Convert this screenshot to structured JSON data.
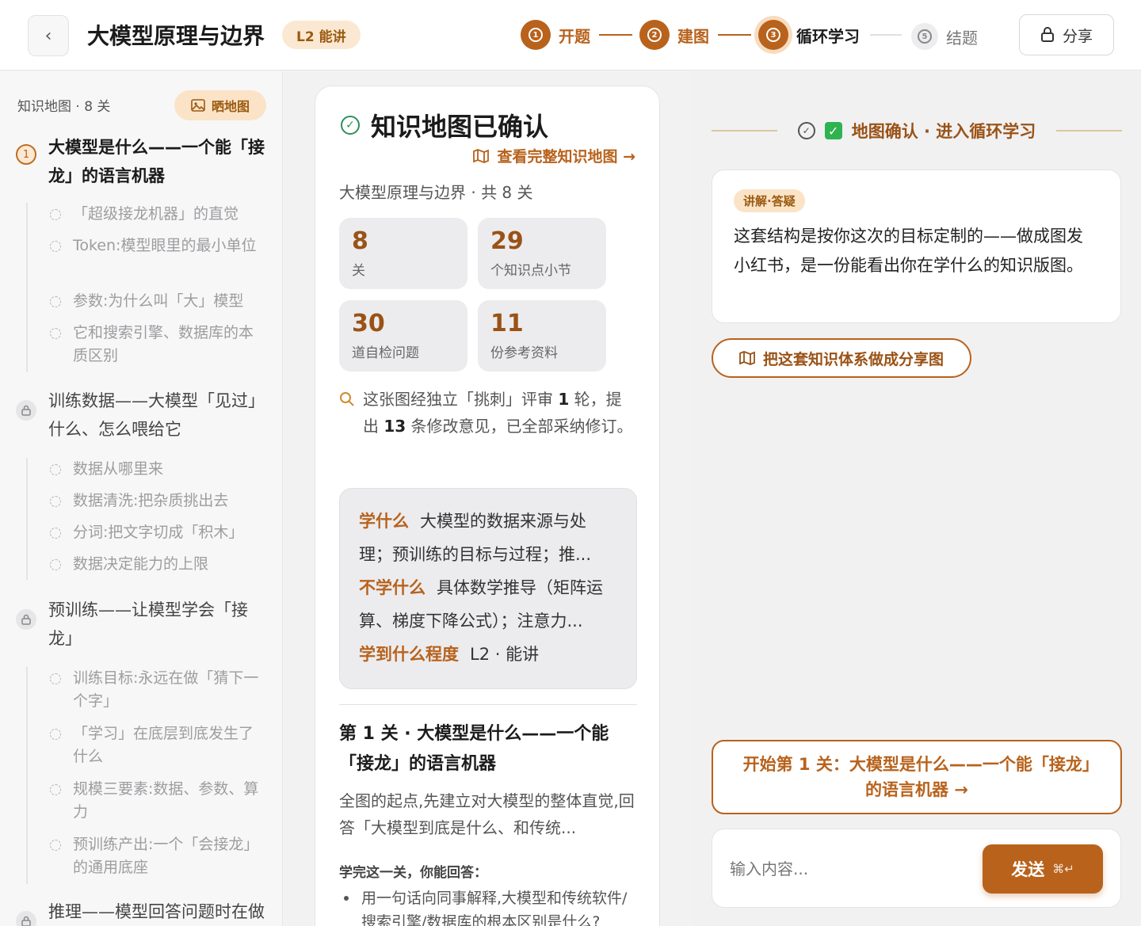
{
  "header": {
    "back_icon": "chevron-left-icon",
    "title": "大模型原理与边界",
    "level_badge": "L2 能讲",
    "steps": [
      {
        "label": "开题",
        "status": "done"
      },
      {
        "label": "建图",
        "status": "done"
      },
      {
        "label": "循环学习",
        "status": "current"
      },
      {
        "label": "结题",
        "status": "future"
      }
    ],
    "share_label": "分享",
    "colors": {
      "accent": "#b8621c",
      "accent_light": "#fbe3c7"
    }
  },
  "sidebar": {
    "heading": "知识地图 · 8 关",
    "show_map_label": "晒地图",
    "chapters": [
      {
        "num": "1",
        "title": "大模型是什么——一个能「接龙」的语言机器",
        "locked": false,
        "items": [
          "「超级接龙机器」的直觉",
          "Token:模型眼里的最小单位",
          "参数:为什么叫「大」模型",
          "它和搜索引擎、数据库的本质区别"
        ]
      },
      {
        "title": "训练数据——大模型「见过」什么、怎么喂给它",
        "locked": true,
        "items": [
          "数据从哪里来",
          "数据清洗:把杂质挑出去",
          "分词:把文字切成「积木」",
          "数据决定能力的上限"
        ]
      },
      {
        "title": "预训练——让模型学会「接龙」",
        "locked": true,
        "items": [
          "训练目标:永远在做「猜下一个字」",
          "「学习」在底层到底发生了什么",
          "规模三要素:数据、参数、算力",
          "预训练产出:一个「会接龙」的通用底座"
        ]
      },
      {
        "title": "推理——模型回答问题时在做",
        "locked": true,
        "items": []
      }
    ]
  },
  "main": {
    "title": "知识地图已确认",
    "view_map_link": "查看完整知识地图 →",
    "subtitle": "大模型原理与边界 · 共 8 关",
    "stats": [
      {
        "value": "8",
        "label": "关"
      },
      {
        "value": "29",
        "label": "个知识点小节"
      },
      {
        "value": "30",
        "label": "道自检问题"
      },
      {
        "value": "11",
        "label": "份参考资料"
      }
    ],
    "review": {
      "pre": "这张图经独立「挑刺」评审 ",
      "rounds": "1",
      "mid": " 轮，提出 ",
      "count": "13",
      "post": " 条修改意见，已全部采纳修订。"
    },
    "scope": {
      "learn_key": "学什么",
      "learn_val": "大模型的数据来源与处理；预训练的目标与过程；推...",
      "skip_key": "不学什么",
      "skip_val": "具体数学推导（矩阵运算、梯度下降公式）；注意力...",
      "depth_key": "学到什么程度",
      "depth_val": "L2 · 能讲"
    },
    "level_title": "第 1 关 · 大模型是什么——一个能「接龙」的语言机器",
    "level_desc": "全图的起点,先建立对大模型的整体直觉,回答「大模型到底是什么、和传统...",
    "level_q_head": "学完这一关，你能回答：",
    "level_q": "用一句话向同事解释,大模型和传统软件/搜索引擎/数据库的根本区别是什么?"
  },
  "chat": {
    "banner": "地图确认 · 进入循环学习",
    "banner_emoji": "✓",
    "message_tag": "讲解·答疑",
    "message_text": "这套结构是按你这次的目标定制的——做成图发小红书，是一份能看出你在学什么的知识版图。",
    "share_map_label": "把这套知识体系做成分享图",
    "start_label": "开始第 1 关：大模型是什么——一个能「接龙」的语言机器 →",
    "input_placeholder": "输入内容...",
    "send_label": "发送",
    "send_shortcut": "⌘↵"
  }
}
